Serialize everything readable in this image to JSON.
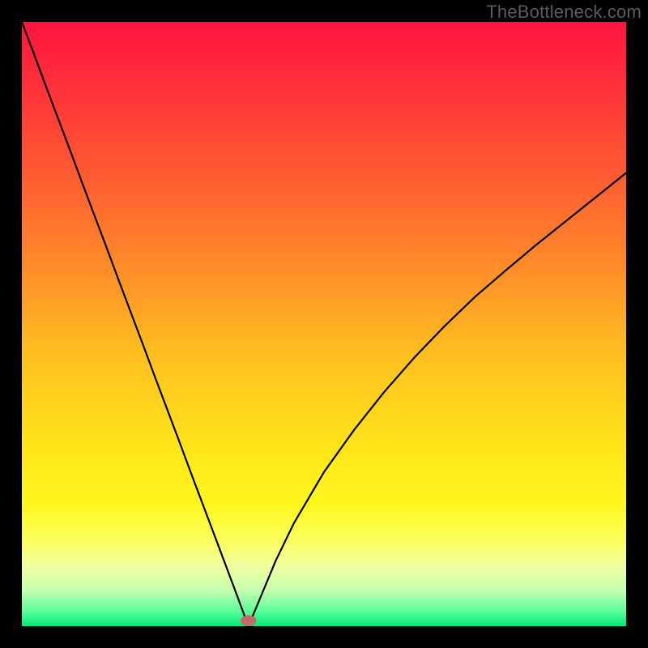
{
  "watermark": "TheBottleneck.com",
  "chart_data": {
    "type": "line",
    "title": "",
    "xlabel": "",
    "ylabel": "",
    "xlim": [
      0,
      100
    ],
    "ylim": [
      0,
      100
    ],
    "axes_visible": false,
    "background": {
      "gradient_stops": [
        {
          "offset": 0.0,
          "color": "#ff1440"
        },
        {
          "offset": 0.1,
          "color": "#ff2f3a"
        },
        {
          "offset": 0.25,
          "color": "#ff5a32"
        },
        {
          "offset": 0.4,
          "color": "#ff8a2a"
        },
        {
          "offset": 0.55,
          "color": "#ffbf20"
        },
        {
          "offset": 0.7,
          "color": "#ffe41a"
        },
        {
          "offset": 0.8,
          "color": "#fff81e"
        },
        {
          "offset": 0.86,
          "color": "#fbff60"
        },
        {
          "offset": 0.9,
          "color": "#f1ffa0"
        },
        {
          "offset": 0.94,
          "color": "#c8ffb0"
        },
        {
          "offset": 0.975,
          "color": "#5cff9a"
        },
        {
          "offset": 1.0,
          "color": "#00e87a"
        }
      ]
    },
    "curve": {
      "color": "#000000",
      "width": 2.2,
      "min_x": 37.5,
      "left_start_y": 100,
      "right_end_y": 75,
      "x": [
        0,
        2,
        4,
        6,
        8,
        10,
        12,
        14,
        16,
        18,
        20,
        22,
        24,
        26,
        28,
        30,
        32,
        33.5,
        35,
        36,
        37,
        37.5,
        38,
        39,
        40,
        42,
        45,
        50,
        55,
        60,
        65,
        70,
        75,
        80,
        85,
        90,
        95,
        100
      ],
      "y": [
        100,
        94.7,
        89.3,
        84.0,
        78.7,
        73.3,
        68.0,
        62.7,
        57.3,
        52.0,
        46.7,
        41.3,
        36.0,
        30.7,
        25.3,
        20.0,
        14.7,
        10.7,
        6.7,
        4.0,
        1.3,
        0.0,
        1.2,
        3.6,
        6.0,
        10.8,
        17.0,
        25.5,
        32.5,
        38.8,
        44.5,
        49.7,
        54.5,
        58.8,
        63.0,
        67.0,
        71.0,
        75.0
      ]
    },
    "marker": {
      "x": 37.5,
      "y": 0.9,
      "rx": 1.3,
      "ry": 0.9,
      "fill": "#c46a6a"
    }
  }
}
